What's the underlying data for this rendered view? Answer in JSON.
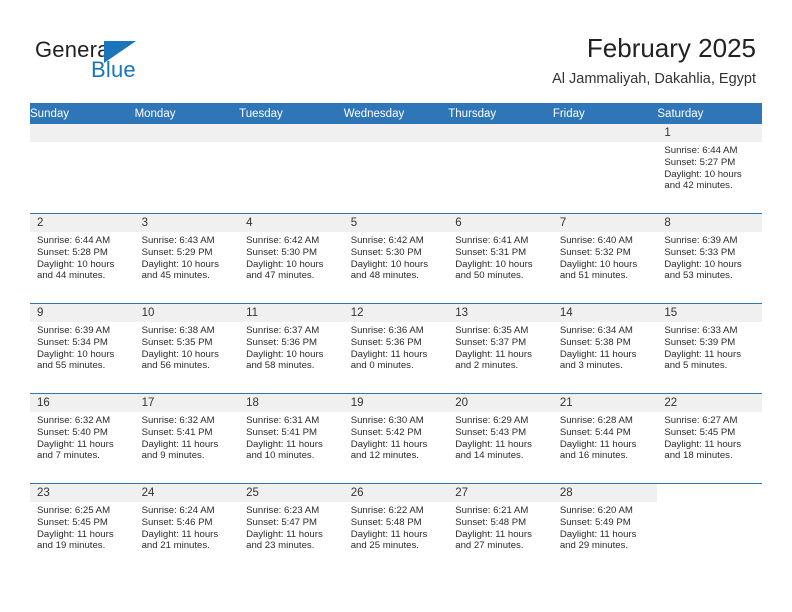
{
  "brand": {
    "name_top": "General",
    "name_bottom": "Blue",
    "accent_color": "#1b75bb"
  },
  "header": {
    "title": "February 2025",
    "subtitle": "Al Jammaliyah, Dakahlia, Egypt"
  },
  "calendar": {
    "header_color": "#2f76b9",
    "daynum_band_color": "#f0f0f0",
    "weekdays": [
      "Sunday",
      "Monday",
      "Tuesday",
      "Wednesday",
      "Thursday",
      "Friday",
      "Saturday"
    ],
    "weeks": [
      [
        {
          "day": "",
          "lines": []
        },
        {
          "day": "",
          "lines": []
        },
        {
          "day": "",
          "lines": []
        },
        {
          "day": "",
          "lines": []
        },
        {
          "day": "",
          "lines": []
        },
        {
          "day": "",
          "lines": []
        },
        {
          "day": "1",
          "lines": [
            "Sunrise: 6:44 AM",
            "Sunset: 5:27 PM",
            "Daylight: 10 hours",
            "and 42 minutes."
          ]
        }
      ],
      [
        {
          "day": "2",
          "lines": [
            "Sunrise: 6:44 AM",
            "Sunset: 5:28 PM",
            "Daylight: 10 hours",
            "and 44 minutes."
          ]
        },
        {
          "day": "3",
          "lines": [
            "Sunrise: 6:43 AM",
            "Sunset: 5:29 PM",
            "Daylight: 10 hours",
            "and 45 minutes."
          ]
        },
        {
          "day": "4",
          "lines": [
            "Sunrise: 6:42 AM",
            "Sunset: 5:30 PM",
            "Daylight: 10 hours",
            "and 47 minutes."
          ]
        },
        {
          "day": "5",
          "lines": [
            "Sunrise: 6:42 AM",
            "Sunset: 5:30 PM",
            "Daylight: 10 hours",
            "and 48 minutes."
          ]
        },
        {
          "day": "6",
          "lines": [
            "Sunrise: 6:41 AM",
            "Sunset: 5:31 PM",
            "Daylight: 10 hours",
            "and 50 minutes."
          ]
        },
        {
          "day": "7",
          "lines": [
            "Sunrise: 6:40 AM",
            "Sunset: 5:32 PM",
            "Daylight: 10 hours",
            "and 51 minutes."
          ]
        },
        {
          "day": "8",
          "lines": [
            "Sunrise: 6:39 AM",
            "Sunset: 5:33 PM",
            "Daylight: 10 hours",
            "and 53 minutes."
          ]
        }
      ],
      [
        {
          "day": "9",
          "lines": [
            "Sunrise: 6:39 AM",
            "Sunset: 5:34 PM",
            "Daylight: 10 hours",
            "and 55 minutes."
          ]
        },
        {
          "day": "10",
          "lines": [
            "Sunrise: 6:38 AM",
            "Sunset: 5:35 PM",
            "Daylight: 10 hours",
            "and 56 minutes."
          ]
        },
        {
          "day": "11",
          "lines": [
            "Sunrise: 6:37 AM",
            "Sunset: 5:36 PM",
            "Daylight: 10 hours",
            "and 58 minutes."
          ]
        },
        {
          "day": "12",
          "lines": [
            "Sunrise: 6:36 AM",
            "Sunset: 5:36 PM",
            "Daylight: 11 hours",
            "and 0 minutes."
          ]
        },
        {
          "day": "13",
          "lines": [
            "Sunrise: 6:35 AM",
            "Sunset: 5:37 PM",
            "Daylight: 11 hours",
            "and 2 minutes."
          ]
        },
        {
          "day": "14",
          "lines": [
            "Sunrise: 6:34 AM",
            "Sunset: 5:38 PM",
            "Daylight: 11 hours",
            "and 3 minutes."
          ]
        },
        {
          "day": "15",
          "lines": [
            "Sunrise: 6:33 AM",
            "Sunset: 5:39 PM",
            "Daylight: 11 hours",
            "and 5 minutes."
          ]
        }
      ],
      [
        {
          "day": "16",
          "lines": [
            "Sunrise: 6:32 AM",
            "Sunset: 5:40 PM",
            "Daylight: 11 hours",
            "and 7 minutes."
          ]
        },
        {
          "day": "17",
          "lines": [
            "Sunrise: 6:32 AM",
            "Sunset: 5:41 PM",
            "Daylight: 11 hours",
            "and 9 minutes."
          ]
        },
        {
          "day": "18",
          "lines": [
            "Sunrise: 6:31 AM",
            "Sunset: 5:41 PM",
            "Daylight: 11 hours",
            "and 10 minutes."
          ]
        },
        {
          "day": "19",
          "lines": [
            "Sunrise: 6:30 AM",
            "Sunset: 5:42 PM",
            "Daylight: 11 hours",
            "and 12 minutes."
          ]
        },
        {
          "day": "20",
          "lines": [
            "Sunrise: 6:29 AM",
            "Sunset: 5:43 PM",
            "Daylight: 11 hours",
            "and 14 minutes."
          ]
        },
        {
          "day": "21",
          "lines": [
            "Sunrise: 6:28 AM",
            "Sunset: 5:44 PM",
            "Daylight: 11 hours",
            "and 16 minutes."
          ]
        },
        {
          "day": "22",
          "lines": [
            "Sunrise: 6:27 AM",
            "Sunset: 5:45 PM",
            "Daylight: 11 hours",
            "and 18 minutes."
          ]
        }
      ],
      [
        {
          "day": "23",
          "lines": [
            "Sunrise: 6:25 AM",
            "Sunset: 5:45 PM",
            "Daylight: 11 hours",
            "and 19 minutes."
          ]
        },
        {
          "day": "24",
          "lines": [
            "Sunrise: 6:24 AM",
            "Sunset: 5:46 PM",
            "Daylight: 11 hours",
            "and 21 minutes."
          ]
        },
        {
          "day": "25",
          "lines": [
            "Sunrise: 6:23 AM",
            "Sunset: 5:47 PM",
            "Daylight: 11 hours",
            "and 23 minutes."
          ]
        },
        {
          "day": "26",
          "lines": [
            "Sunrise: 6:22 AM",
            "Sunset: 5:48 PM",
            "Daylight: 11 hours",
            "and 25 minutes."
          ]
        },
        {
          "day": "27",
          "lines": [
            "Sunrise: 6:21 AM",
            "Sunset: 5:48 PM",
            "Daylight: 11 hours",
            "and 27 minutes."
          ]
        },
        {
          "day": "28",
          "lines": [
            "Sunrise: 6:20 AM",
            "Sunset: 5:49 PM",
            "Daylight: 11 hours",
            "and 29 minutes."
          ]
        },
        {
          "day": "",
          "lines": [],
          "blank": true
        }
      ]
    ]
  }
}
